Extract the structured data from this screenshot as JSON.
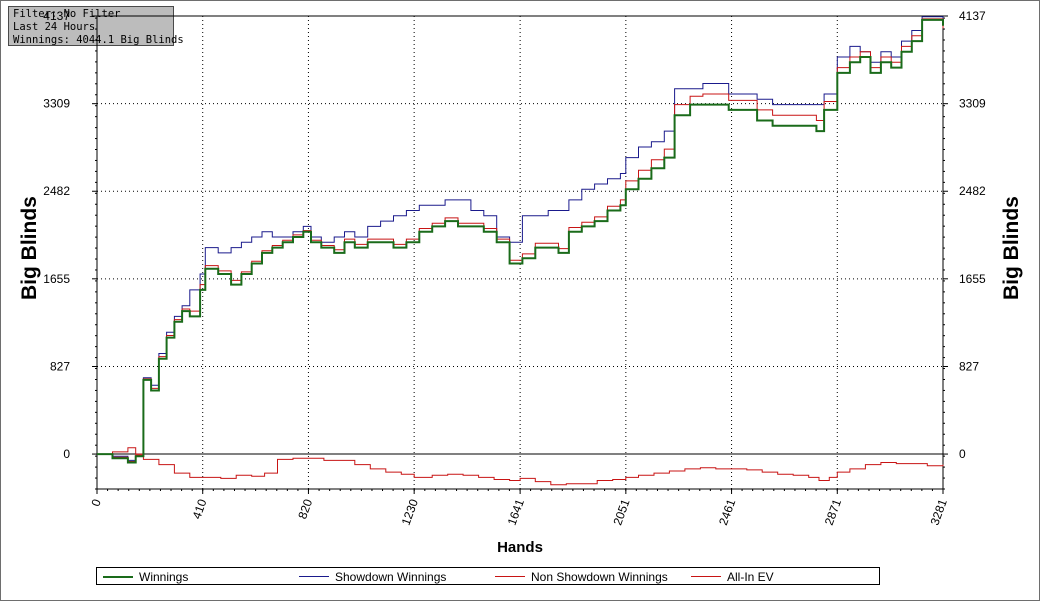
{
  "info": {
    "filter": "Filter: No Filter",
    "period": "Last  24 Hours",
    "winnings": "Winnings: 4044.1 Big Blinds"
  },
  "colors": {
    "winnings": "#1a6b1a",
    "showdown": "#1a1a8c",
    "non_showdown": "#c81414",
    "allin_ev": "#c81414",
    "grid": "#000000"
  },
  "chart_data": {
    "type": "line",
    "xlabel": "Hands",
    "ylabel": "Big Blinds",
    "xlim": [
      0,
      3281
    ],
    "ylim": [
      -330,
      4137
    ],
    "x_ticks": [
      "0",
      "410",
      "820",
      "1230",
      "1641",
      "2051",
      "2461",
      "2871",
      "3281"
    ],
    "y_ticks": [
      "0",
      "827",
      "1655",
      "2482",
      "3309",
      "4137"
    ],
    "grid": true,
    "legend_position": "bottom",
    "series": [
      {
        "name": "Winnings",
        "color": "#1a6b1a",
        "points": [
          [
            0,
            0
          ],
          [
            60,
            -40
          ],
          [
            120,
            -80
          ],
          [
            150,
            -20
          ],
          [
            180,
            700
          ],
          [
            210,
            600
          ],
          [
            240,
            900
          ],
          [
            270,
            1100
          ],
          [
            300,
            1250
          ],
          [
            330,
            1350
          ],
          [
            360,
            1300
          ],
          [
            400,
            1550
          ],
          [
            420,
            1750
          ],
          [
            470,
            1700
          ],
          [
            520,
            1600
          ],
          [
            560,
            1700
          ],
          [
            600,
            1800
          ],
          [
            640,
            1900
          ],
          [
            680,
            1950
          ],
          [
            720,
            2000
          ],
          [
            760,
            2050
          ],
          [
            800,
            2100
          ],
          [
            830,
            2000
          ],
          [
            870,
            1950
          ],
          [
            920,
            1900
          ],
          [
            960,
            2000
          ],
          [
            1000,
            1950
          ],
          [
            1050,
            2000
          ],
          [
            1100,
            2000
          ],
          [
            1150,
            1950
          ],
          [
            1200,
            2000
          ],
          [
            1250,
            2100
          ],
          [
            1300,
            2150
          ],
          [
            1350,
            2200
          ],
          [
            1400,
            2150
          ],
          [
            1450,
            2150
          ],
          [
            1500,
            2100
          ],
          [
            1550,
            2000
          ],
          [
            1600,
            1800
          ],
          [
            1650,
            1850
          ],
          [
            1700,
            1950
          ],
          [
            1750,
            1950
          ],
          [
            1790,
            1900
          ],
          [
            1830,
            2100
          ],
          [
            1880,
            2150
          ],
          [
            1930,
            2200
          ],
          [
            1980,
            2300
          ],
          [
            2030,
            2350
          ],
          [
            2051,
            2500
          ],
          [
            2100,
            2600
          ],
          [
            2150,
            2700
          ],
          [
            2200,
            2800
          ],
          [
            2240,
            3200
          ],
          [
            2300,
            3300
          ],
          [
            2350,
            3300
          ],
          [
            2400,
            3300
          ],
          [
            2450,
            3250
          ],
          [
            2500,
            3250
          ],
          [
            2560,
            3150
          ],
          [
            2620,
            3100
          ],
          [
            2680,
            3100
          ],
          [
            2740,
            3100
          ],
          [
            2790,
            3050
          ],
          [
            2820,
            3250
          ],
          [
            2871,
            3600
          ],
          [
            2920,
            3700
          ],
          [
            2960,
            3750
          ],
          [
            3000,
            3600
          ],
          [
            3040,
            3700
          ],
          [
            3080,
            3650
          ],
          [
            3120,
            3800
          ],
          [
            3160,
            3900
          ],
          [
            3200,
            4100
          ],
          [
            3281,
            4044
          ]
        ]
      },
      {
        "name": "Showdown Winnings",
        "color": "#1a1a8c",
        "points": [
          [
            0,
            0
          ],
          [
            60,
            -20
          ],
          [
            120,
            -60
          ],
          [
            150,
            -20
          ],
          [
            180,
            720
          ],
          [
            210,
            650
          ],
          [
            240,
            950
          ],
          [
            270,
            1150
          ],
          [
            300,
            1300
          ],
          [
            330,
            1400
          ],
          [
            360,
            1550
          ],
          [
            400,
            1700
          ],
          [
            420,
            1950
          ],
          [
            470,
            1900
          ],
          [
            520,
            1950
          ],
          [
            560,
            2000
          ],
          [
            600,
            2050
          ],
          [
            640,
            2100
          ],
          [
            680,
            2050
          ],
          [
            720,
            2050
          ],
          [
            760,
            2100
          ],
          [
            800,
            2150
          ],
          [
            830,
            2050
          ],
          [
            870,
            2000
          ],
          [
            920,
            2050
          ],
          [
            960,
            2100
          ],
          [
            1000,
            2050
          ],
          [
            1050,
            2150
          ],
          [
            1100,
            2200
          ],
          [
            1150,
            2250
          ],
          [
            1200,
            2300
          ],
          [
            1250,
            2350
          ],
          [
            1300,
            2350
          ],
          [
            1350,
            2400
          ],
          [
            1400,
            2400
          ],
          [
            1450,
            2300
          ],
          [
            1500,
            2250
          ],
          [
            1550,
            2050
          ],
          [
            1600,
            2000
          ],
          [
            1650,
            2250
          ],
          [
            1700,
            2250
          ],
          [
            1750,
            2300
          ],
          [
            1790,
            2300
          ],
          [
            1830,
            2400
          ],
          [
            1880,
            2500
          ],
          [
            1930,
            2550
          ],
          [
            1980,
            2600
          ],
          [
            2030,
            2650
          ],
          [
            2051,
            2800
          ],
          [
            2100,
            2900
          ],
          [
            2150,
            2950
          ],
          [
            2200,
            3050
          ],
          [
            2240,
            3450
          ],
          [
            2300,
            3450
          ],
          [
            2350,
            3500
          ],
          [
            2400,
            3500
          ],
          [
            2450,
            3400
          ],
          [
            2500,
            3400
          ],
          [
            2560,
            3350
          ],
          [
            2620,
            3300
          ],
          [
            2680,
            3300
          ],
          [
            2740,
            3300
          ],
          [
            2790,
            3300
          ],
          [
            2820,
            3400
          ],
          [
            2871,
            3750
          ],
          [
            2920,
            3850
          ],
          [
            2960,
            3800
          ],
          [
            3000,
            3700
          ],
          [
            3040,
            3800
          ],
          [
            3080,
            3750
          ],
          [
            3120,
            3900
          ],
          [
            3160,
            4000
          ],
          [
            3200,
            4130
          ],
          [
            3281,
            4100
          ]
        ]
      },
      {
        "name": "Non Showdown Winnings",
        "color": "#c81414",
        "points": [
          [
            0,
            0
          ],
          [
            60,
            20
          ],
          [
            120,
            60
          ],
          [
            150,
            0
          ],
          [
            180,
            -50
          ],
          [
            240,
            -100
          ],
          [
            300,
            -180
          ],
          [
            360,
            -220
          ],
          [
            420,
            -220
          ],
          [
            480,
            -230
          ],
          [
            540,
            -200
          ],
          [
            600,
            -210
          ],
          [
            650,
            -180
          ],
          [
            700,
            -50
          ],
          [
            760,
            -40
          ],
          [
            820,
            -40
          ],
          [
            880,
            -60
          ],
          [
            940,
            -60
          ],
          [
            1000,
            -100
          ],
          [
            1060,
            -140
          ],
          [
            1120,
            -170
          ],
          [
            1180,
            -190
          ],
          [
            1230,
            -220
          ],
          [
            1300,
            -200
          ],
          [
            1360,
            -190
          ],
          [
            1420,
            -200
          ],
          [
            1480,
            -220
          ],
          [
            1540,
            -240
          ],
          [
            1600,
            -250
          ],
          [
            1641,
            -230
          ],
          [
            1700,
            -260
          ],
          [
            1760,
            -290
          ],
          [
            1820,
            -280
          ],
          [
            1880,
            -280
          ],
          [
            1940,
            -250
          ],
          [
            2000,
            -240
          ],
          [
            2051,
            -220
          ],
          [
            2100,
            -200
          ],
          [
            2160,
            -180
          ],
          [
            2220,
            -160
          ],
          [
            2280,
            -140
          ],
          [
            2340,
            -130
          ],
          [
            2400,
            -140
          ],
          [
            2461,
            -140
          ],
          [
            2520,
            -150
          ],
          [
            2580,
            -170
          ],
          [
            2640,
            -190
          ],
          [
            2700,
            -200
          ],
          [
            2760,
            -220
          ],
          [
            2800,
            -250
          ],
          [
            2840,
            -220
          ],
          [
            2871,
            -170
          ],
          [
            2920,
            -140
          ],
          [
            2980,
            -100
          ],
          [
            3040,
            -80
          ],
          [
            3100,
            -90
          ],
          [
            3160,
            -90
          ],
          [
            3220,
            -110
          ],
          [
            3281,
            -100
          ]
        ]
      },
      {
        "name": "All-In EV",
        "color": "#c81414",
        "points": [
          [
            0,
            0
          ],
          [
            60,
            -30
          ],
          [
            120,
            -70
          ],
          [
            150,
            -10
          ],
          [
            180,
            710
          ],
          [
            210,
            620
          ],
          [
            240,
            920
          ],
          [
            270,
            1120
          ],
          [
            300,
            1270
          ],
          [
            330,
            1370
          ],
          [
            360,
            1350
          ],
          [
            400,
            1600
          ],
          [
            420,
            1780
          ],
          [
            470,
            1730
          ],
          [
            520,
            1640
          ],
          [
            560,
            1720
          ],
          [
            600,
            1820
          ],
          [
            640,
            1920
          ],
          [
            680,
            1970
          ],
          [
            720,
            2020
          ],
          [
            760,
            2070
          ],
          [
            800,
            2110
          ],
          [
            830,
            2020
          ],
          [
            870,
            1970
          ],
          [
            920,
            1930
          ],
          [
            960,
            2030
          ],
          [
            1000,
            1980
          ],
          [
            1050,
            2030
          ],
          [
            1100,
            2030
          ],
          [
            1150,
            1980
          ],
          [
            1200,
            2030
          ],
          [
            1250,
            2130
          ],
          [
            1300,
            2180
          ],
          [
            1350,
            2230
          ],
          [
            1400,
            2180
          ],
          [
            1450,
            2180
          ],
          [
            1500,
            2130
          ],
          [
            1550,
            2030
          ],
          [
            1600,
            1830
          ],
          [
            1650,
            1890
          ],
          [
            1700,
            1990
          ],
          [
            1750,
            1990
          ],
          [
            1790,
            1940
          ],
          [
            1830,
            2140
          ],
          [
            1880,
            2190
          ],
          [
            1930,
            2240
          ],
          [
            1980,
            2340
          ],
          [
            2030,
            2400
          ],
          [
            2051,
            2580
          ],
          [
            2100,
            2680
          ],
          [
            2150,
            2780
          ],
          [
            2200,
            2880
          ],
          [
            2240,
            3300
          ],
          [
            2300,
            3380
          ],
          [
            2350,
            3400
          ],
          [
            2400,
            3400
          ],
          [
            2450,
            3340
          ],
          [
            2500,
            3340
          ],
          [
            2560,
            3250
          ],
          [
            2620,
            3200
          ],
          [
            2680,
            3200
          ],
          [
            2740,
            3200
          ],
          [
            2790,
            3150
          ],
          [
            2820,
            3330
          ],
          [
            2871,
            3650
          ],
          [
            2920,
            3750
          ],
          [
            2960,
            3800
          ],
          [
            3000,
            3650
          ],
          [
            3040,
            3750
          ],
          [
            3080,
            3700
          ],
          [
            3120,
            3850
          ],
          [
            3160,
            3950
          ],
          [
            3200,
            4110
          ],
          [
            3281,
            4020
          ]
        ]
      }
    ]
  }
}
